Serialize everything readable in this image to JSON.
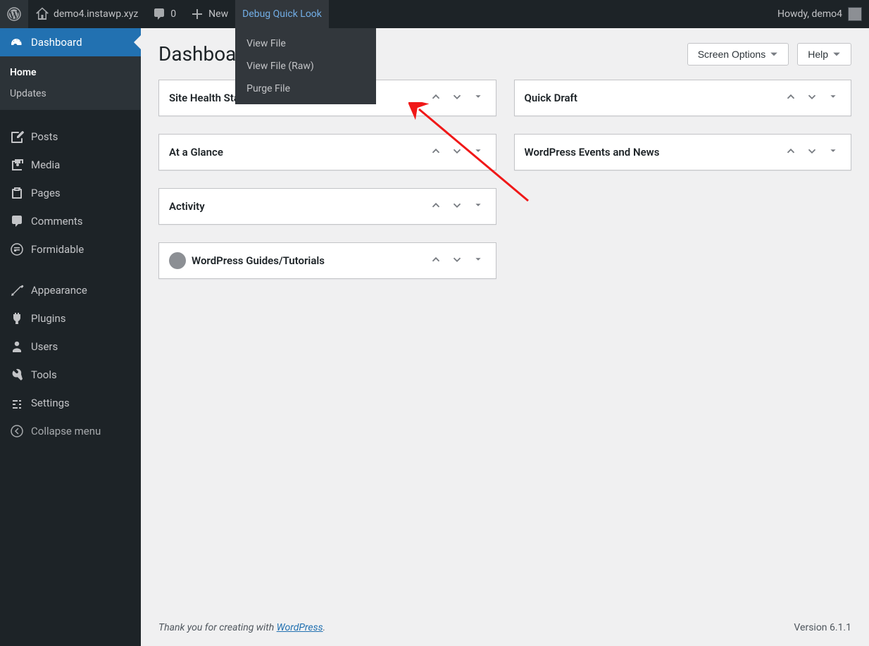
{
  "adminBar": {
    "siteName": "demo4.instawp.xyz",
    "commentCount": "0",
    "newLabel": "New",
    "debugLabel": "Debug Quick Look",
    "howdy": "Howdy, demo4",
    "dropdown": {
      "viewFile": "View File",
      "viewFileRaw": "View File (Raw)",
      "purgeFile": "Purge File"
    }
  },
  "sidebar": {
    "dashboard": "Dashboard",
    "home": "Home",
    "updates": "Updates",
    "posts": "Posts",
    "media": "Media",
    "pages": "Pages",
    "comments": "Comments",
    "formidable": "Formidable",
    "appearance": "Appearance",
    "plugins": "Plugins",
    "users": "Users",
    "tools": "Tools",
    "settings": "Settings",
    "collapse": "Collapse menu"
  },
  "page": {
    "title": "Dashboard",
    "screenOptions": "Screen Options",
    "help": "Help"
  },
  "widgets": {
    "siteHealth": "Site Health Status",
    "ataglance": "At a Glance",
    "activity": "Activity",
    "guides": "WordPress Guides/Tutorials",
    "quickDraft": "Quick Draft",
    "events": "WordPress Events and News"
  },
  "footer": {
    "thankYou": "Thank you for creating with ",
    "wordpress": "WordPress",
    "period": ".",
    "version": "Version 6.1.1"
  }
}
